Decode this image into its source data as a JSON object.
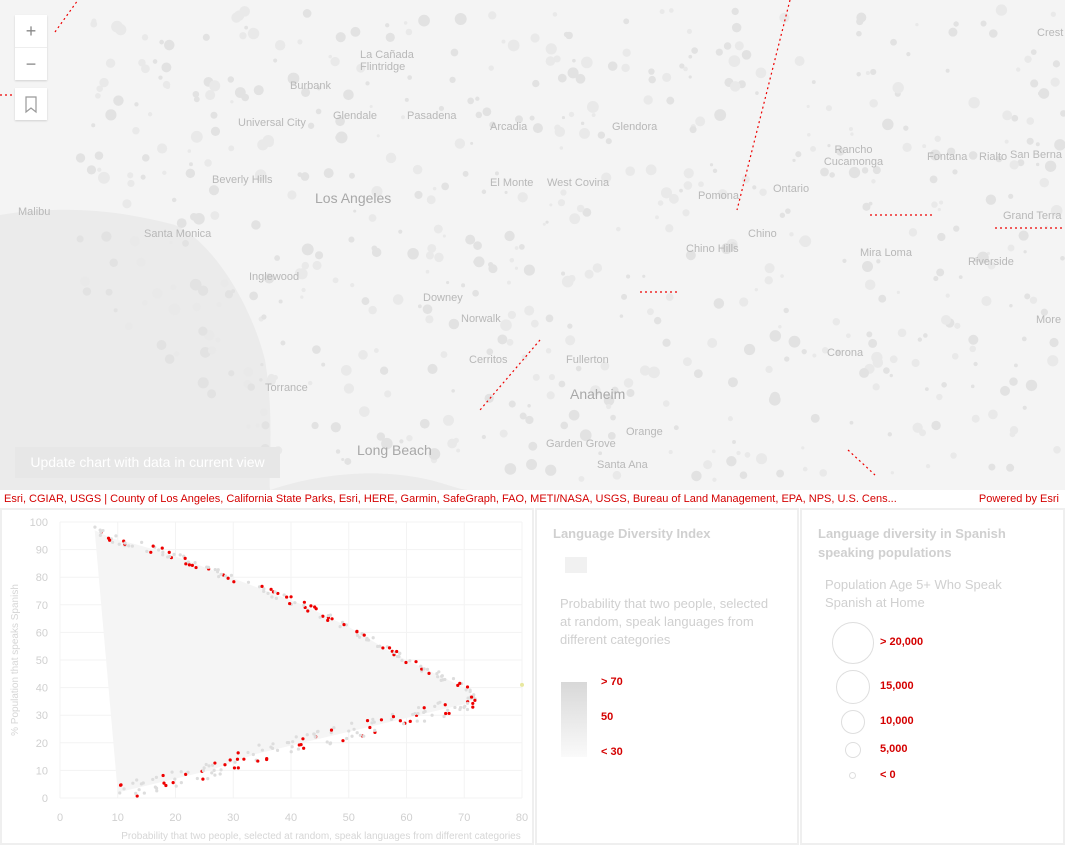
{
  "map": {
    "places": [
      {
        "name": "La Cañada Flintridge",
        "cls": ""
      },
      {
        "name": "Burbank",
        "cls": ""
      },
      {
        "name": "Glendale",
        "cls": ""
      },
      {
        "name": "Pasadena",
        "cls": ""
      },
      {
        "name": "Universal City",
        "cls": ""
      },
      {
        "name": "Arcadia",
        "cls": ""
      },
      {
        "name": "Glendora",
        "cls": ""
      },
      {
        "name": "Rancho Cucamonga",
        "cls": ""
      },
      {
        "name": "Fontana",
        "cls": ""
      },
      {
        "name": "Rialto",
        "cls": ""
      },
      {
        "name": "San Berna",
        "cls": ""
      },
      {
        "name": "Beverly Hills",
        "cls": ""
      },
      {
        "name": "Los Angeles",
        "cls": "big"
      },
      {
        "name": "El Monte",
        "cls": ""
      },
      {
        "name": "West Covina",
        "cls": ""
      },
      {
        "name": "Pomona",
        "cls": ""
      },
      {
        "name": "Ontario",
        "cls": ""
      },
      {
        "name": "Malibu",
        "cls": ""
      },
      {
        "name": "Santa Monica",
        "cls": ""
      },
      {
        "name": "Chino Hills",
        "cls": ""
      },
      {
        "name": "Chino",
        "cls": ""
      },
      {
        "name": "Grand Terra",
        "cls": ""
      },
      {
        "name": "Mira Loma",
        "cls": ""
      },
      {
        "name": "Riverside",
        "cls": ""
      },
      {
        "name": "Inglewood",
        "cls": ""
      },
      {
        "name": "Downey",
        "cls": ""
      },
      {
        "name": "Norwalk",
        "cls": ""
      },
      {
        "name": "More",
        "cls": ""
      },
      {
        "name": "Cerritos",
        "cls": ""
      },
      {
        "name": "Fullerton",
        "cls": ""
      },
      {
        "name": "Corona",
        "cls": ""
      },
      {
        "name": "Torrance",
        "cls": ""
      },
      {
        "name": "Anaheim",
        "cls": "big"
      },
      {
        "name": "Orange",
        "cls": ""
      },
      {
        "name": "Garden Grove",
        "cls": ""
      },
      {
        "name": "Long Beach",
        "cls": "big"
      },
      {
        "name": "Santa Ana",
        "cls": ""
      },
      {
        "name": "Crest",
        "cls": ""
      }
    ],
    "zoom_in": "+",
    "zoom_out": "−",
    "update_button": "Update chart with data in current view",
    "attribution_left": "Esri, CGIAR, USGS | County of Los Angeles, California State Parks, Esri, HERE, Garmin, SafeGraph, FAO, METI/NASA, USGS, Bureau of Land Management, EPA, NPS, U.S. Cens...",
    "attribution_right": "Powered by Esri"
  },
  "chart_data": {
    "type": "scatter",
    "xlabel": "Probability that two people, selected at random, speak languages from different categories",
    "ylabel": "% Population that speaks Spanish",
    "xlim": [
      0,
      80
    ],
    "ylim": [
      0,
      100
    ],
    "xticks": [
      0,
      10,
      20,
      30,
      40,
      50,
      60,
      70,
      80
    ],
    "yticks": [
      0,
      10,
      20,
      30,
      40,
      50,
      60,
      70,
      80,
      90,
      100
    ],
    "upper_band": [
      [
        6,
        97
      ],
      [
        9,
        94
      ],
      [
        13,
        92
      ],
      [
        18,
        89
      ],
      [
        22,
        86
      ],
      [
        27,
        82
      ],
      [
        32,
        78
      ],
      [
        37,
        74
      ],
      [
        42,
        70
      ],
      [
        46,
        66
      ],
      [
        50,
        62
      ],
      [
        54,
        57
      ],
      [
        58,
        52
      ],
      [
        62,
        48
      ],
      [
        66,
        44
      ],
      [
        70,
        40
      ],
      [
        72,
        36
      ]
    ],
    "lower_band": [
      [
        10,
        2
      ],
      [
        14,
        4
      ],
      [
        18,
        6
      ],
      [
        22,
        8
      ],
      [
        26,
        10
      ],
      [
        30,
        13
      ],
      [
        34,
        16
      ],
      [
        38,
        18
      ],
      [
        42,
        20
      ],
      [
        46,
        22
      ],
      [
        50,
        24
      ],
      [
        54,
        26
      ],
      [
        58,
        28
      ],
      [
        62,
        30
      ],
      [
        66,
        32
      ],
      [
        70,
        34
      ],
      [
        72,
        36
      ]
    ],
    "outlier": [
      [
        80,
        41
      ]
    ]
  },
  "ldi_legend": {
    "title": "Language Diversity Index",
    "description": "Probability that two people, selected at random, speak languages from different categories",
    "labels": [
      "> 70",
      "50",
      "< 30"
    ]
  },
  "spanish_legend": {
    "title": "Language diversity in Spanish speaking populations",
    "subtitle": "Population Age 5+ Who Speak Spanish at Home",
    "labels": [
      "> 20,000",
      "15,000",
      "10,000",
      "5,000",
      "< 0"
    ]
  }
}
